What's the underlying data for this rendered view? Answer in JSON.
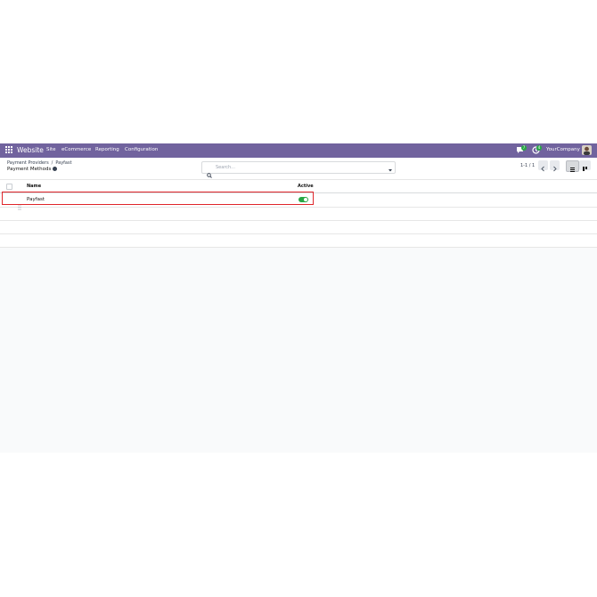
{
  "navbar": {
    "brand": "Website",
    "menu": [
      "Site",
      "eCommerce",
      "Reporting",
      "Configuration"
    ],
    "company": "YourCompany",
    "badges": {
      "messages": "7",
      "activities": "4"
    }
  },
  "breadcrumb": {
    "parent": "Payment Providers",
    "separator": "/",
    "current": "Payfast"
  },
  "page_title": "Payment Methods",
  "search": {
    "placeholder": "Search..."
  },
  "pager": "1-1 / 1",
  "table": {
    "columns": {
      "name": "Name",
      "active": "Active"
    },
    "rows": [
      {
        "name": "Payfast",
        "active": true
      }
    ]
  },
  "colors": {
    "navbar": "#71639e",
    "toggle_on": "#28a745",
    "highlight": "#e0262b"
  }
}
